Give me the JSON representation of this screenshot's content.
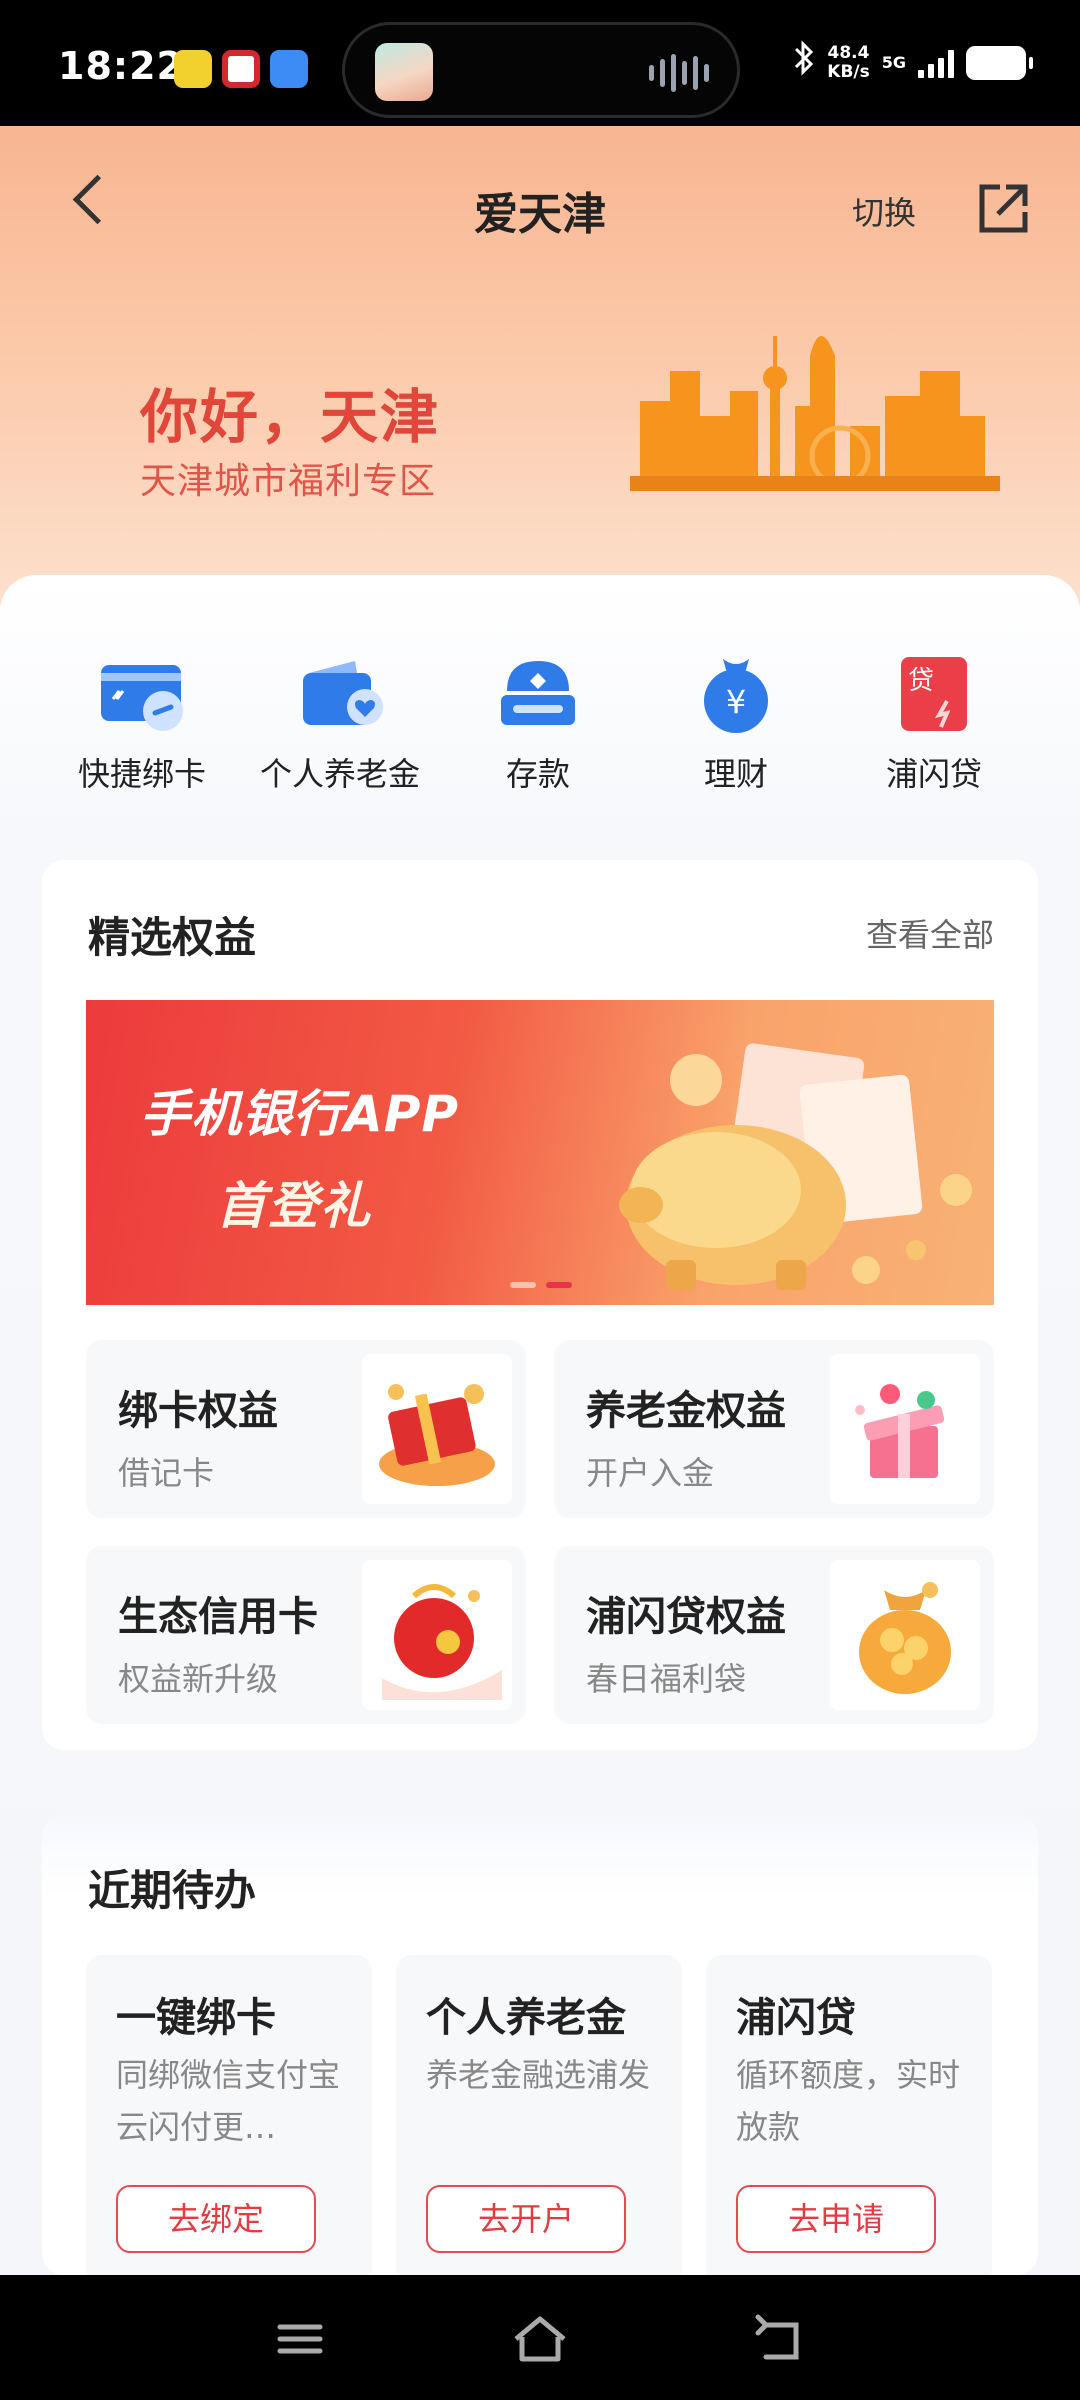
{
  "status_bar": {
    "time": "18:22",
    "speed_value": "48.4",
    "speed_unit": "KB/s",
    "network": "5G",
    "bluetooth_icon": "bluetooth-icon",
    "battery_icon": "battery-icon"
  },
  "header": {
    "title": "爱天津",
    "switch_label": "切换",
    "greeting": "你好，天津",
    "greeting_sub": "天津城市福利专区"
  },
  "shortcuts": [
    {
      "label": "快捷绑卡",
      "icon": "card-link-icon"
    },
    {
      "label": "个人养老金",
      "icon": "wallet-heart-icon"
    },
    {
      "label": "存款",
      "icon": "deposit-icon"
    },
    {
      "label": "理财",
      "icon": "money-bag-icon"
    },
    {
      "label": "浦闪贷",
      "icon": "loan-icon"
    }
  ],
  "loan_icon_text": "贷",
  "benefits": {
    "title": "精选权益",
    "view_all": "查看全部",
    "banner": {
      "line1": "手机银行APP",
      "line2": "首登礼"
    },
    "cards": [
      {
        "title": "绑卡权益",
        "subtitle": "借记卡"
      },
      {
        "title": "养老金权益",
        "subtitle": "开户入金"
      },
      {
        "title": "生态信用卡",
        "subtitle": "权益新升级"
      },
      {
        "title": "浦闪贷权益",
        "subtitle": "春日福利袋"
      }
    ]
  },
  "todos": {
    "title": "近期待办",
    "items": [
      {
        "title": "一键绑卡",
        "desc": "同绑微信支付宝云闪付更…",
        "button": "去绑定"
      },
      {
        "title": "个人养老金",
        "desc": "养老金融选浦发",
        "button": "去开户"
      },
      {
        "title": "浦闪贷",
        "desc": "循环额度，实时放款",
        "button": "去申请"
      }
    ]
  },
  "colors": {
    "accent_red": "#e23b40",
    "icon_blue": "#2f7ce8",
    "header_orange": "#f8b592"
  }
}
